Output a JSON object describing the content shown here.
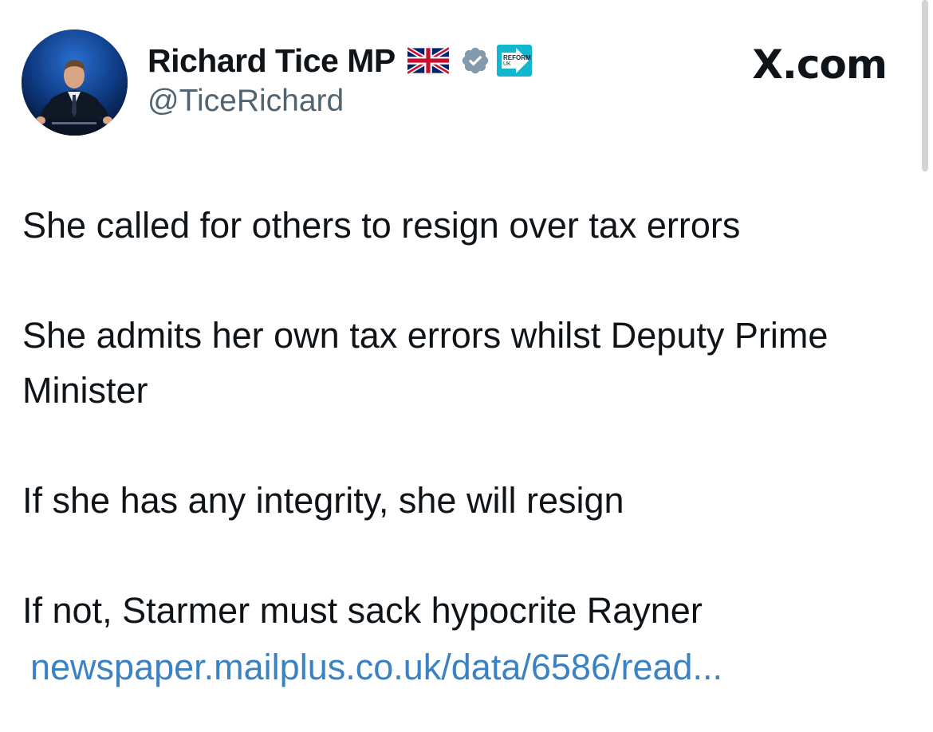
{
  "author": {
    "display_name": "Richard Tice MP",
    "handle": "@TiceRichard",
    "badges": {
      "flag": "union-jack-flag-icon",
      "verified": "verified-badge-icon",
      "party_logo": "reform-uk-logo-icon",
      "party_logo_text_line1": "REFORM",
      "party_logo_text_line2": "UK"
    }
  },
  "site": {
    "logo_text": "X.com"
  },
  "tweet": {
    "paragraphs": [
      "She called for others to resign over tax errors",
      "She admits her own tax errors whilst Deputy Prime Minister",
      "If she has any integrity, she will resign"
    ],
    "last_paragraph": "If not, Starmer must sack hypocrite Rayner",
    "link_text": "newspaper.mailplus.co.uk/data/6586/read..."
  },
  "colors": {
    "text": "#0f1419",
    "secondary_text": "#536471",
    "link": "#3b82c4",
    "verified_badge": "#829aab",
    "reform_logo": "#12b6cf"
  }
}
